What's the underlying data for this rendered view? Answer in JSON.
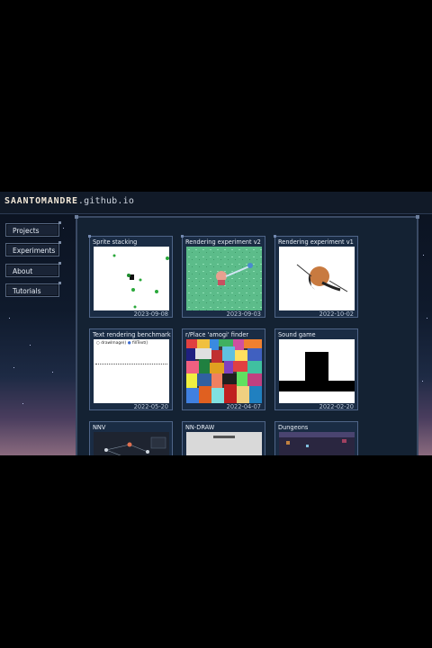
{
  "site": {
    "brand": "SAANTOMANDRE",
    "domain": ".github.io"
  },
  "nav": [
    {
      "label": "Projects"
    },
    {
      "label": "Experiments"
    },
    {
      "label": "About"
    },
    {
      "label": "Tutorials"
    }
  ],
  "cards": [
    {
      "title": "Sprite stacking",
      "date": "2023-09-08"
    },
    {
      "title": "Rendering experiment v2",
      "date": "2023-09-03"
    },
    {
      "title": "Rendering experiment v1",
      "date": "2022-10-02"
    },
    {
      "title": "Text rendering benchmark",
      "date": "2022-05-20",
      "thumb_text": [
        "drawImage()",
        "fillText()"
      ]
    },
    {
      "title": "r/Place 'amogi' finder",
      "date": "2022-04-07"
    },
    {
      "title": "Sound game",
      "date": "2022-02-20"
    },
    {
      "title": "NNV",
      "date": ""
    },
    {
      "title": "NN-DRAW",
      "date": ""
    },
    {
      "title": "Dungeons",
      "date": ""
    }
  ],
  "colors": {
    "background": "#0f1a2c",
    "panel": "#142233",
    "card_border": "#4f6588",
    "text": "#e8eef6"
  }
}
